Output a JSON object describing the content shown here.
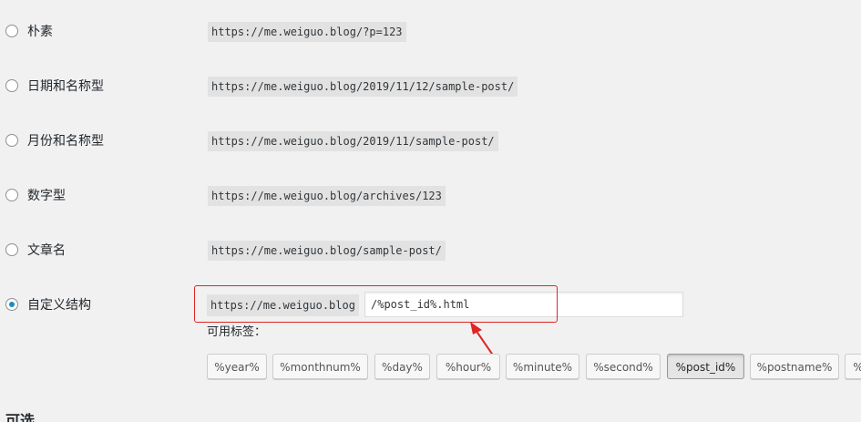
{
  "options": [
    {
      "label": "朴素",
      "url": "https://me.weiguo.blog/?p=123",
      "checked": false
    },
    {
      "label": "日期和名称型",
      "url": "https://me.weiguo.blog/2019/11/12/sample-post/",
      "checked": false
    },
    {
      "label": "月份和名称型",
      "url": "https://me.weiguo.blog/2019/11/sample-post/",
      "checked": false
    },
    {
      "label": "数字型",
      "url": "https://me.weiguo.blog/archives/123",
      "checked": false
    },
    {
      "label": "文章名",
      "url": "https://me.weiguo.blog/sample-post/",
      "checked": false
    }
  ],
  "custom": {
    "label": "自定义结构",
    "base": "https://me.weiguo.blog",
    "value": "/%post_id%.html",
    "checked": true
  },
  "available_tags_label": "可用标签：",
  "tags": [
    {
      "label": "%year%",
      "active": false
    },
    {
      "label": "%monthnum%",
      "active": false
    },
    {
      "label": "%day%",
      "active": false
    },
    {
      "label": "%hour%",
      "active": false
    },
    {
      "label": "%minute%",
      "active": false
    },
    {
      "label": "%second%",
      "active": false
    },
    {
      "label": "%post_id%",
      "active": true
    },
    {
      "label": "%postname%",
      "active": false
    },
    {
      "label": "%",
      "active": false
    }
  ],
  "next_section_heading": "可选",
  "colors": {
    "annotation": "#e02424",
    "radio_checked": "#1e8cbe"
  }
}
